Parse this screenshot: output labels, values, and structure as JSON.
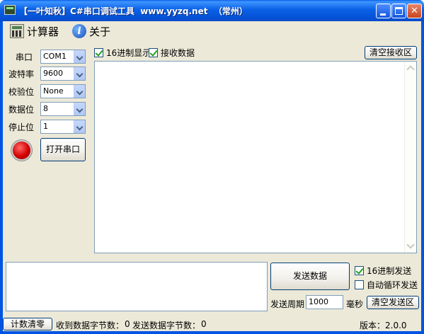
{
  "window": {
    "title": "【一叶知秋】C#串口调试工具  www.yyzq.net  （常州）"
  },
  "menu": {
    "calculator": "计算器",
    "about": "关于"
  },
  "settings": {
    "port_label": "串口",
    "port_value": "COM1",
    "baud_label": "波特率",
    "baud_value": "9600",
    "parity_label": "校验位",
    "parity_value": "None",
    "databits_label": "数据位",
    "databits_value": "8",
    "stopbits_label": "停止位",
    "stopbits_value": "1",
    "open_button": "打开串口",
    "status_color": "#d40000"
  },
  "receive": {
    "hex_display_label": "16进制显示",
    "hex_display_checked": true,
    "receive_data_label": "接收数据",
    "receive_data_checked": true,
    "clear_button": "清空接收区",
    "content": ""
  },
  "send": {
    "content": "",
    "send_button": "发送数据",
    "hex_send_label": "16进制发送",
    "hex_send_checked": true,
    "auto_loop_label": "自动循环发送",
    "auto_loop_checked": false,
    "period_label": "发送周期",
    "period_value": "1000",
    "period_unit": "毫秒",
    "clear_button": "清空发送区"
  },
  "status": {
    "reset_button": "计数清零",
    "received_label": "收到数据字节数：",
    "received_count": "0",
    "sent_label": "发送数据字节数：",
    "sent_count": "0",
    "version": "版本：2.0.0"
  }
}
